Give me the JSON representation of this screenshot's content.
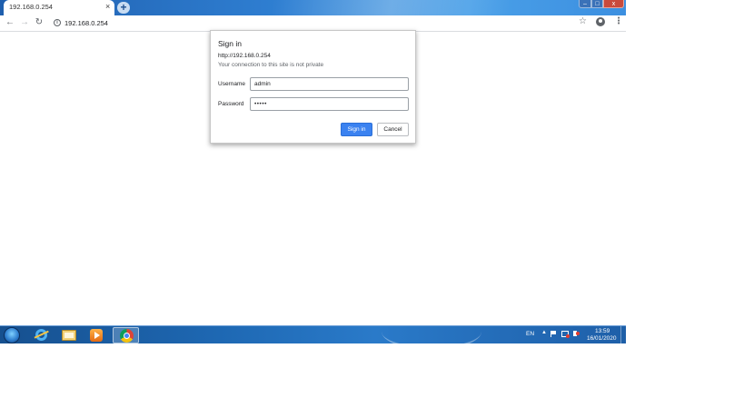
{
  "browser": {
    "tab_title": "192.168.0.254",
    "tab_close": "×",
    "new_tab": "+",
    "url": "192.168.0.254",
    "window_controls": {
      "minimize": "–",
      "maximize": "□",
      "close": "x"
    }
  },
  "dialog": {
    "title": "Sign in",
    "url": "http://192.168.0.254",
    "note": "Your connection to this site is not private",
    "username_label": "Username",
    "username_value": "admin",
    "password_label": "Password",
    "password_value": "•••••",
    "sign_in_label": "Sign in",
    "cancel_label": "Cancel",
    "accent_color": "#3b82f0"
  },
  "taskbar": {
    "language": "EN",
    "tray_up": "▲",
    "time": "13:59",
    "date": "16/01/2020",
    "pinned": [
      "ie-icon",
      "explorer-icon",
      "media-player-icon",
      "chrome-icon"
    ]
  }
}
